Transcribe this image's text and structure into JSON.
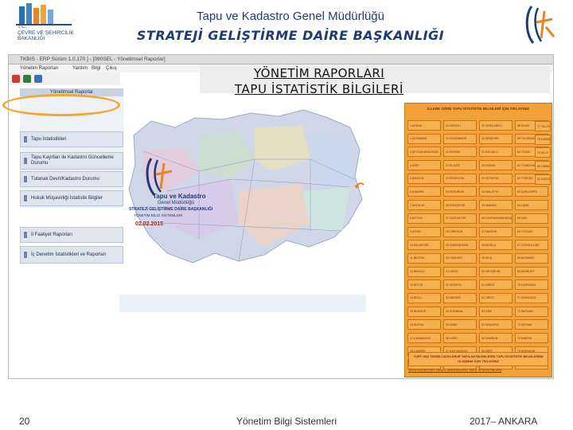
{
  "header": {
    "ministry_logo_lines": [
      "T.C.",
      "ÇEVRE VE ŞEHİRCİLİK",
      "BAKANLIĞI"
    ],
    "title": "Tapu ve Kadastro Genel Müdürlüğü",
    "subtitle": "STRATEJİ GELİŞTİRME DAİRE BAŞKANLIĞI"
  },
  "app": {
    "titlebar": "TKBIS - ERP     Sürüm 1.0.170 ] - [090SEL - Yönetimsel Raporlar]",
    "menu": [
      "Yönetim Raporları",
      "Yardım",
      "Bilgi",
      "Çıkış"
    ],
    "report_title_1": "YÖNETİM RAPORLARI",
    "report_title_2": "TAPU İSTATİSTİK BİLGİLERİ",
    "sidebar": {
      "header": "Yönetimsel Raporlar",
      "items": [
        {
          "label": "Tapu İstatistikleri"
        },
        {
          "label": "Tapu Kayıtları ile Kadastro Güncelleme Durumu"
        },
        {
          "label": "Tutanak Devri/Kadastro Durumu"
        },
        {
          "label": "Hukuk Müşavirliği İstatistik Bilgiler"
        },
        {
          "label": "İl Faaliyet Raporları"
        },
        {
          "label": "İç Denetim İstatistikleri ve Raporları"
        }
      ]
    },
    "map": {
      "logo_brand": "Tapu ve Kadastro",
      "logo_sub": "Genel Müdürlüğü",
      "dept": "STRATEJİ GELİŞTİRME DAİRE BAŞKANLIĞI",
      "unit": "YÖNETİM BİLGİ SİSTEMLERİ",
      "date": "02.02.2015"
    },
    "province_panel": {
      "header": "İLLERE GÖRE TAPU İSTATİSTİK BİLGİLERİ İÇİN TIKLAYINIZ",
      "rows": [
        [
          "1 ADANA",
          "20 DENİZLİ",
          "39 KIRKLARELİ",
          "58 SİVAS"
        ],
        [
          "2 ADIYAMAN",
          "21 DİYARBAKIR",
          "40 KIRŞEHİR",
          "59 TEKİRDAĞ"
        ],
        [
          "3 AFYONKARAHİSAR",
          "22 EDİRNE",
          "41 KOCAELİ",
          "60 TOKAT"
        ],
        [
          "4 AĞRI",
          "23 ELAZIĞ",
          "42 KONYA",
          "61 TRABZON"
        ],
        [
          "5 AMASYA",
          "24 ERZİNCAN",
          "43 KÜTAHYA",
          "62 TUNCELİ"
        ],
        [
          "6 ANKARA",
          "25 ERZURUM",
          "44 MALATYA",
          "63 ŞANLIURFA"
        ],
        [
          "7 ANTALYA",
          "26 ESKİŞEHİR",
          "45 MANİSA",
          "64 UŞAK"
        ],
        [
          "8 ARTVİN",
          "27 GAZİANTEP",
          "46 KAHRAMANMARAŞ",
          "65 VAN"
        ],
        [
          "9 AYDIN",
          "28 GİRESUN",
          "47 MARDİN",
          "66 YOZGAT"
        ],
        [
          "10 BALIKESİR",
          "29 GÜMÜŞHANE",
          "48 MUĞLA",
          "67 ZONGULDAK"
        ],
        [
          "11 BİLECİK",
          "30 HAKKARİ",
          "49 MUŞ",
          "68 AKSARAY"
        ],
        [
          "12 BİNGÖL",
          "31 HATAY",
          "50 NEVŞEHİR",
          "69 BAYBURT"
        ],
        [
          "13 BİTLİS",
          "32 ISPARTA",
          "51 NİĞDE",
          "70 KARAMAN"
        ],
        [
          "14 BOLU",
          "33 MERSİN",
          "52 ORDU",
          "71 KIRIKKALE"
        ],
        [
          "15 BURDUR",
          "34 İSTANBUL",
          "53 RİZE",
          "72 BATMAN"
        ],
        [
          "16 BURSA",
          "35 İZMİR",
          "54 SAKARYA",
          "73 ŞIRNAK"
        ],
        [
          "17 ÇANAKKALE",
          "36 KARS",
          "55 SAMSUN",
          "74 BARTIN"
        ],
        [
          "18 ÇANKIRI",
          "37 KASTAMONU",
          "56 SİİRT",
          "75 ARDAHAN"
        ],
        [
          "19 ÇORUM",
          "38 KAYSERİ",
          "57 SİNOP",
          "76 IĞDIR"
        ]
      ],
      "extra_col": [
        "77 YALOVA",
        "78 KARABÜK",
        "79 KİLİS",
        "80 OSMANİYE",
        "81 DÜZCE"
      ],
      "footer_box": "YURT DIŞI TEMSİLCİLİKLERDE YAPILAN İŞLEMLERİN TAPU İSTATİSTİK BİLGİLERİNE ULAŞMAK İÇİN TIKLAYINIZ",
      "footer_link": "TAPU KADASTRO GENEL MÜDÜRLÜĞÜ TAPU İSTATİSTİKLERİ"
    }
  },
  "footer": {
    "page": "20",
    "center": "Yönetim Bilgi Sistemleri",
    "right": "2017– ANKARA"
  },
  "colors": {
    "navy": "#1f3b73",
    "orange_panel": "#f2a13b",
    "highlight": "#f2a830"
  }
}
